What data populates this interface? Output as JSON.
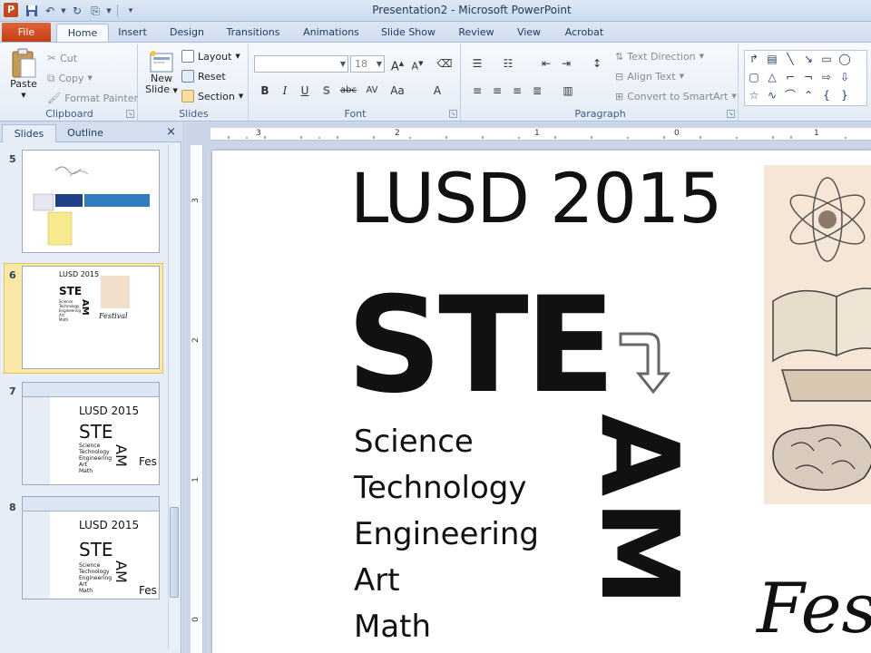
{
  "window": {
    "title": "Presentation2 - Microsoft PowerPoint",
    "app_icon_letter": "P"
  },
  "tabs": {
    "file": "File",
    "items": [
      "Home",
      "Insert",
      "Design",
      "Transitions",
      "Animations",
      "Slide Show",
      "Review",
      "View",
      "Acrobat"
    ],
    "active": "Home"
  },
  "ribbon": {
    "clipboard": {
      "label": "Clipboard",
      "paste": "Paste",
      "cut": "Cut",
      "copy": "Copy",
      "format_painter": "Format Painter"
    },
    "slides": {
      "label": "Slides",
      "new_slide_line1": "New",
      "new_slide_line2": "Slide",
      "layout": "Layout",
      "reset": "Reset",
      "section": "Section"
    },
    "font": {
      "label": "Font",
      "font_name": "",
      "font_size": "18"
    },
    "paragraph": {
      "label": "Paragraph",
      "text_direction": "Text Direction",
      "align_text": "Align Text",
      "convert_smartart": "Convert to SmartArt"
    }
  },
  "panel": {
    "tab_slides": "Slides",
    "tab_outline": "Outline",
    "close_glyph": "×",
    "thumbnails": [
      {
        "number": "5"
      },
      {
        "number": "6",
        "title": "LUSD 2015",
        "ste": "STE",
        "am": "AM",
        "festival": "Festival",
        "list": [
          "Science",
          "Technology",
          "Engineering",
          "Art",
          "Math"
        ]
      },
      {
        "number": "7",
        "title": "LUSD 2015",
        "ste": "STE",
        "am": "AM",
        "festival": "Fes",
        "list": [
          "Science",
          "Technology",
          "Engineering",
          "Art",
          "Math"
        ]
      },
      {
        "number": "8",
        "title": "LUSD 2015",
        "ste": "STE",
        "am": "AM",
        "festival": "Fes",
        "list": [
          "Science",
          "Technology",
          "Engineering",
          "Art",
          "Math"
        ]
      }
    ]
  },
  "ruler": {
    "horizontal": [
      "3",
      "2",
      "1",
      "0",
      "1"
    ],
    "vertical": [
      "3",
      "2",
      "1",
      "0"
    ]
  },
  "slide": {
    "title": "LUSD 2015",
    "ste": "STE",
    "am": "AM",
    "festival": "Fes",
    "list": [
      "Science",
      "Technology",
      "Engineering",
      "Art",
      "Math"
    ]
  }
}
